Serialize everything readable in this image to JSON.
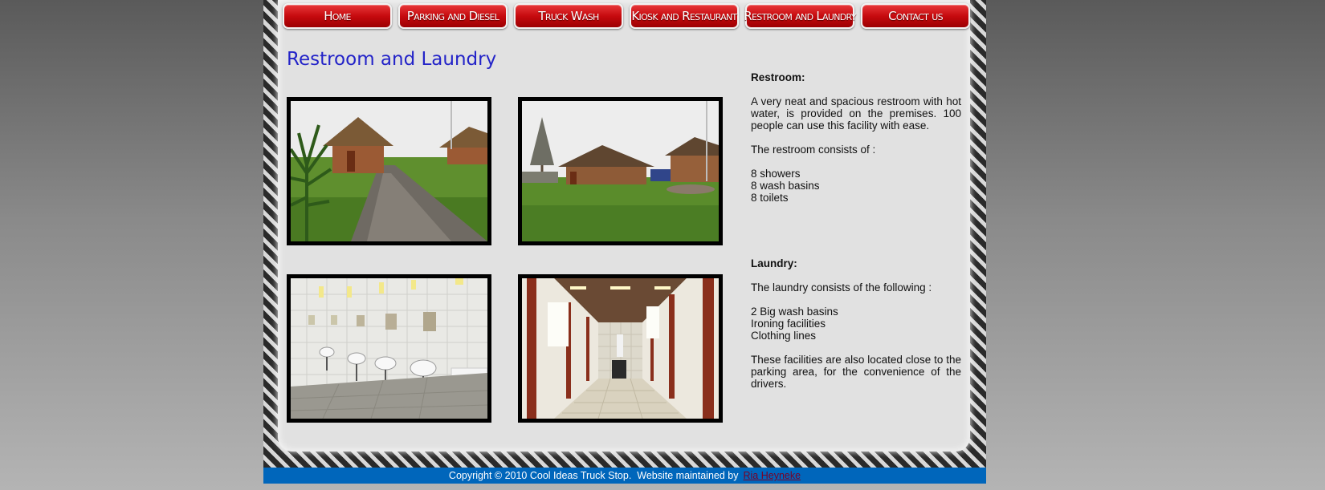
{
  "nav": {
    "items": [
      {
        "label": "Home"
      },
      {
        "label": "Parking and Diesel"
      },
      {
        "label": "Truck Wash"
      },
      {
        "label": "Kiosk and Restaurant"
      },
      {
        "label": "Restroom and Laundry"
      },
      {
        "label": "Contact us"
      }
    ]
  },
  "page": {
    "title": "Restroom and Laundry"
  },
  "restroom": {
    "heading": "Restroom:",
    "intro": "A very neat and spacious restroom with hot water, is provided on the premises. 100 people can use this facility with ease.",
    "consists": "The restroom consists of :",
    "items": [
      "8 showers",
      "8 wash basins",
      "8 toilets"
    ]
  },
  "laundry": {
    "heading": "Laundry:",
    "consists": "The laundry consists of the following :",
    "items": [
      "2 Big wash basins",
      "Ironing facilities",
      "Clothing lines"
    ],
    "note": "These facilities are also located close to the parking area, for the convenience of the drivers."
  },
  "footer": {
    "copyright": "Copyright © 2010 Cool Ideas Truck Stop.  Website maintained by",
    "link_label": "Ria Heyneke"
  },
  "colors": {
    "nav_red": "#c60a0e",
    "title_blue": "#2323c8",
    "footer_blue": "#0066bb",
    "link": "#7a0025"
  }
}
